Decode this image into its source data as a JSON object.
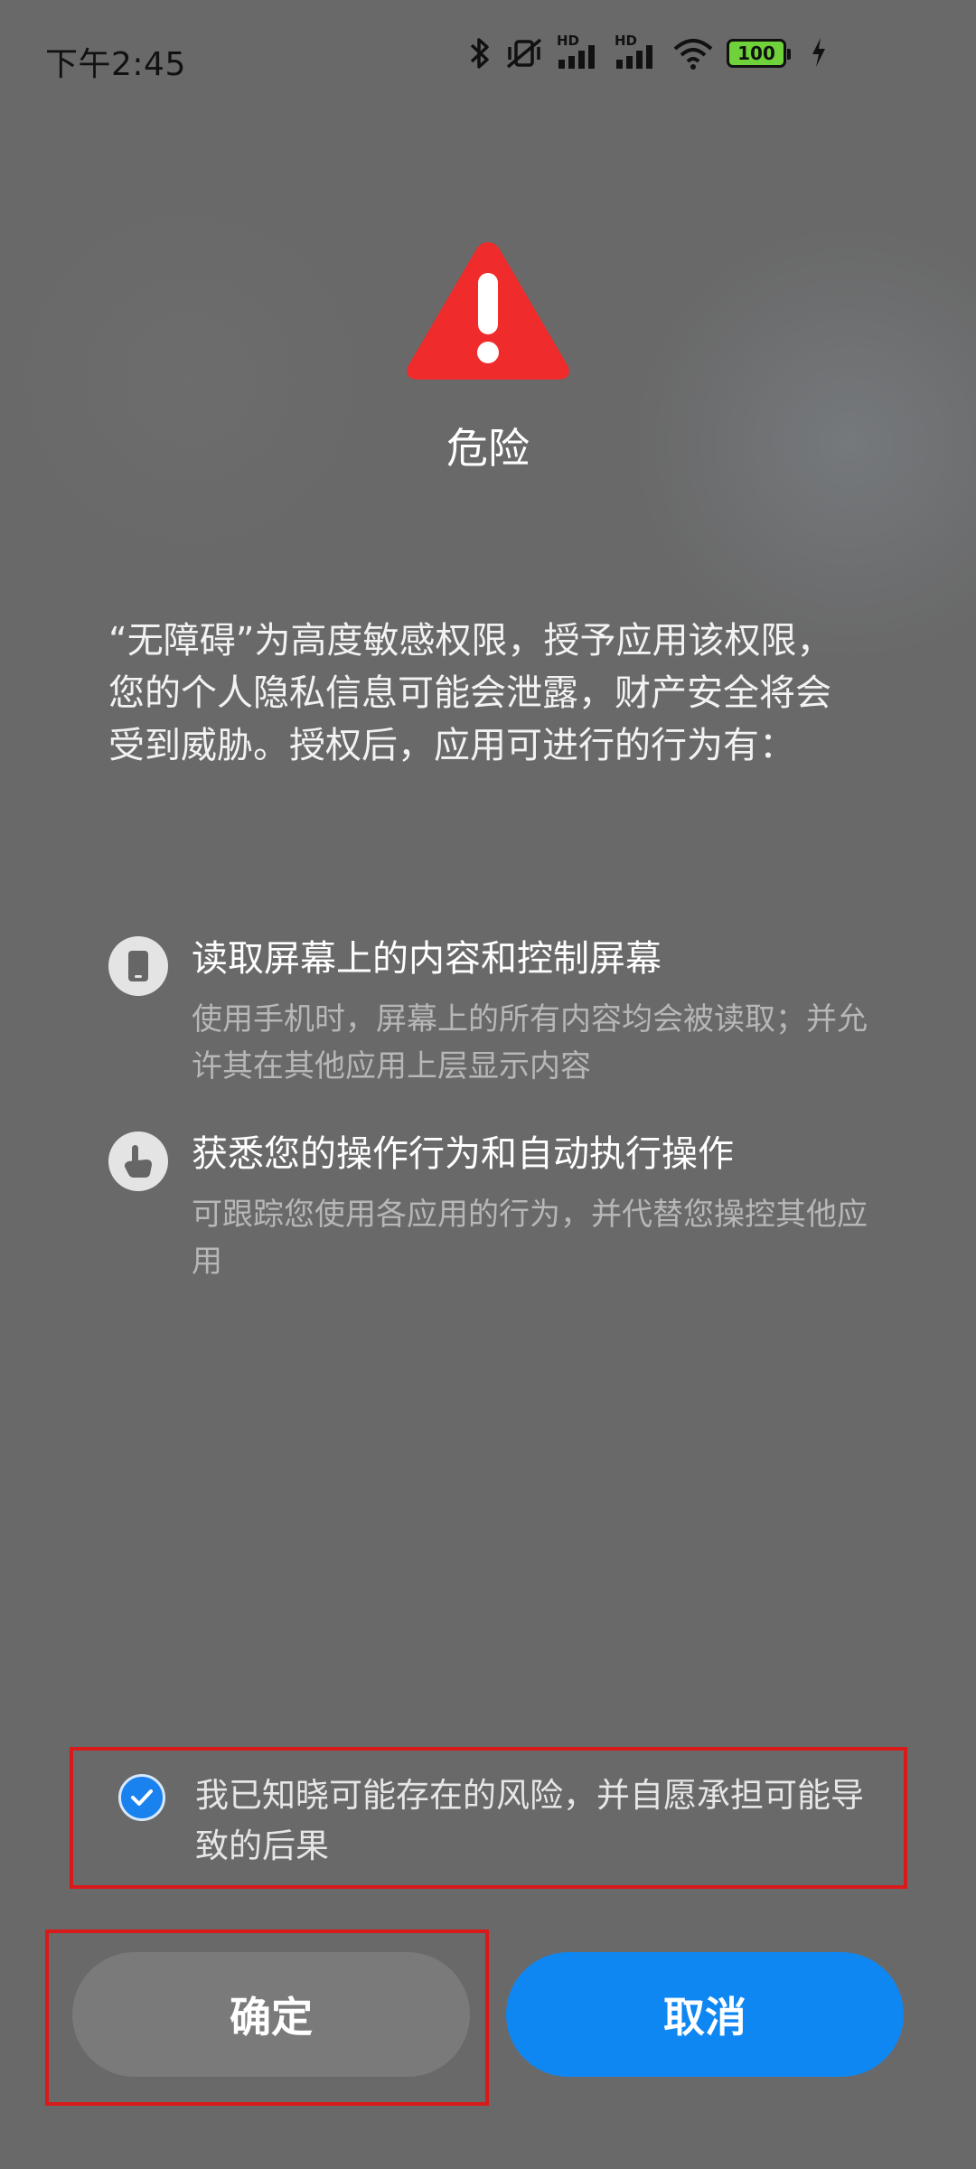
{
  "status_bar": {
    "time": "下午2:45",
    "signal_label_1": "HD",
    "signal_label_2": "HD",
    "battery": "100",
    "icons": [
      "bluetooth-icon",
      "vibrate-mute-icon",
      "signal-icon",
      "signal-icon",
      "wifi-icon",
      "battery-icon",
      "charging-icon"
    ]
  },
  "dialog": {
    "icon": "warning-icon",
    "icon_color": "#ef2b2b",
    "title": "危险",
    "description": "“无障碍”为高度敏感权限，授予应用该权限，您的个人隐私信息可能会泄露，财产安全将会受到威胁。授权后，应用可进行的行为有：",
    "permissions": [
      {
        "icon": "phone-icon",
        "title": "读取屏幕上的内容和控制屏幕",
        "description": "使用手机时，屏幕上的所有内容均会被读取；并允许其在其他应用上层显示内容"
      },
      {
        "icon": "hand-pointer-icon",
        "title": "获悉您的操作行为和自动执行操作",
        "description": "可跟踪您使用各应用的行为，并代替您操控其他应用"
      }
    ],
    "acknowledge": {
      "checked": true,
      "text": "我已知晓可能存在的风险，并自愿承担可能导致的后果"
    },
    "buttons": {
      "confirm": "确定",
      "cancel": "取消"
    },
    "colors": {
      "accent": "#0f87f3",
      "highlight_outline": "#d91a1a"
    }
  }
}
